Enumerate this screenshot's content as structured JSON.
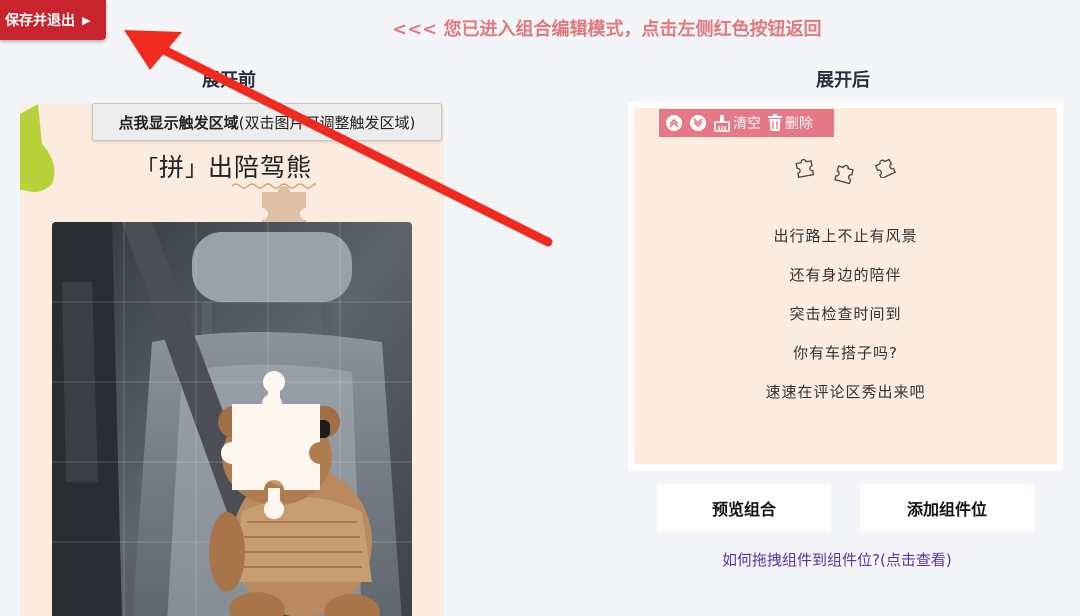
{
  "top": {
    "save_exit_label": "保存并退出",
    "mode_message": "<<< 您已进入组合编辑模式，点击左侧红色按钮返回"
  },
  "columns": {
    "before_title": "展开前",
    "after_title": "展开后"
  },
  "left_preview": {
    "title_bracket_char": "拼",
    "title_rest": "出陪驾熊",
    "hint_button_bold": "点我显示触发区域",
    "hint_button_rest": "(双击图片可调整触发区域)"
  },
  "right_panel": {
    "toolbar": {
      "clear_label": "清空",
      "delete_label": "删除"
    },
    "poem_lines": [
      "出行路上不止有风景",
      "还有身边的陪伴",
      "突击检查时间到",
      "你有车搭子吗?",
      "速速在评论区秀出来吧"
    ]
  },
  "buttons": {
    "preview_label": "预览组合",
    "add_slot_label": "添加组件位",
    "howto_link": "如何拖拽组件到组件位?(点击查看)"
  },
  "colors": {
    "save_button": "#c8242e",
    "mode_message": "#e07a7f",
    "toolbar": "#e67888",
    "canvas_bg": "#fcece0",
    "link": "#5a34a8",
    "arrow": "#f02a1e"
  }
}
